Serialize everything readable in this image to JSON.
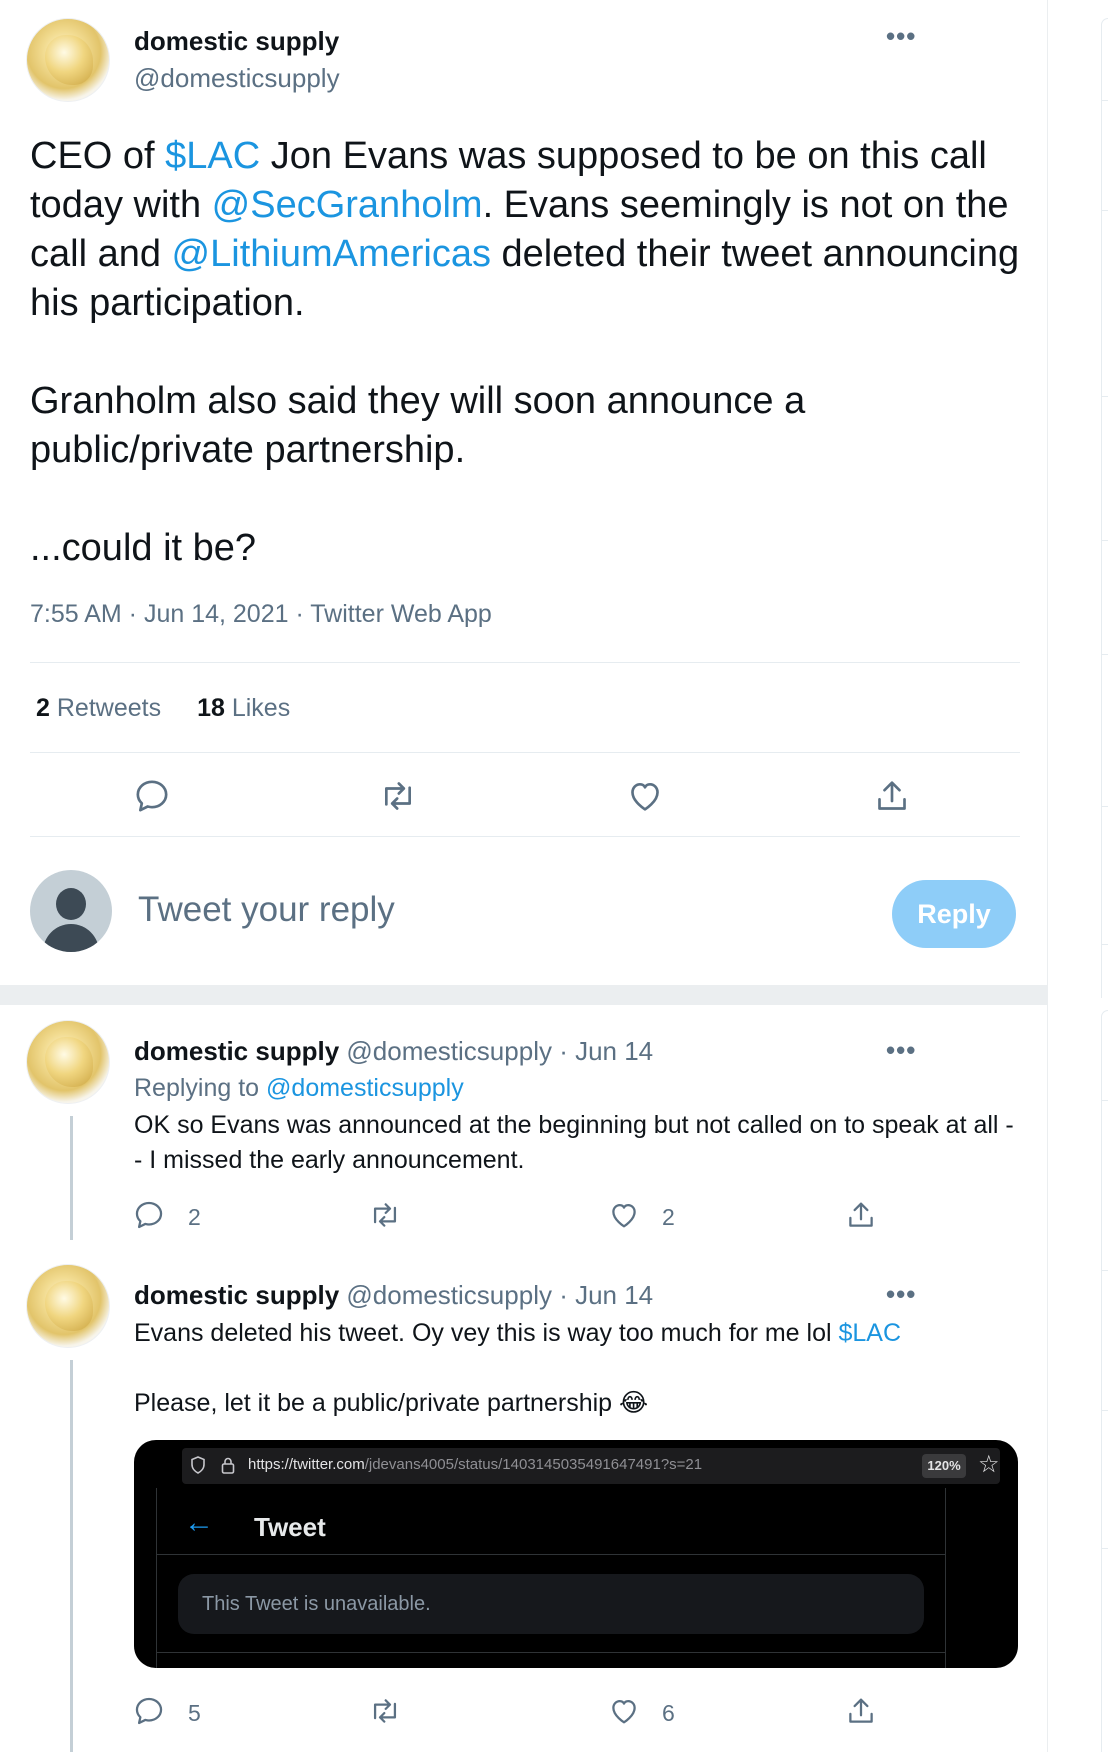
{
  "main_tweet": {
    "author_name": "domestic supply",
    "author_handle": "@domesticsupply",
    "more_label": "•••",
    "p1": {
      "t1": "CEO of ",
      "cashtag": "$LAC",
      "t2": " Jon Evans was supposed to be on this call today with ",
      "mention1": "@SecGranholm",
      "t3": ". Evans seemingly is not on the call and ",
      "mention2": "@LithiumAmericas",
      "t4": " deleted their tweet announcing his participation."
    },
    "p2": "Granholm also said they will soon announce a public/private partnership.",
    "p3": "...could it be?",
    "timestamp": "7:55 AM · Jun 14, 2021 · Twitter Web App",
    "retweets_count": "2",
    "retweets_label": "Retweets",
    "likes_count": "18",
    "likes_label": "Likes"
  },
  "reply_box": {
    "placeholder": "Tweet your reply",
    "button_label": "Reply"
  },
  "thread": [
    {
      "author_name": "domestic supply",
      "meta": " @domesticsupply · Jun 14",
      "replying_prefix": "Replying to ",
      "replying_handle": "@domesticsupply",
      "text": "OK so Evans was announced at the beginning but not called on to speak at all -- I missed the early announcement.",
      "reply_count": "2",
      "like_count": "2"
    },
    {
      "author_name": "domestic supply",
      "meta": " @domesticsupply · Jun 14",
      "text_line1": "Evans deleted his tweet. Oy vey this is way too much for me lol  ",
      "cashtag": "$LAC",
      "text_line2": "Please, let it be a public/private partnership ",
      "emoji": "😂",
      "reply_count": "5",
      "like_count": "6",
      "embed": {
        "url_domain": "https://twitter.com",
        "url_path": "/jdevans4005/status/1403145035491647491?s=21",
        "zoom": "120%",
        "title": "Tweet",
        "message": "This Tweet is unavailable."
      }
    }
  ]
}
